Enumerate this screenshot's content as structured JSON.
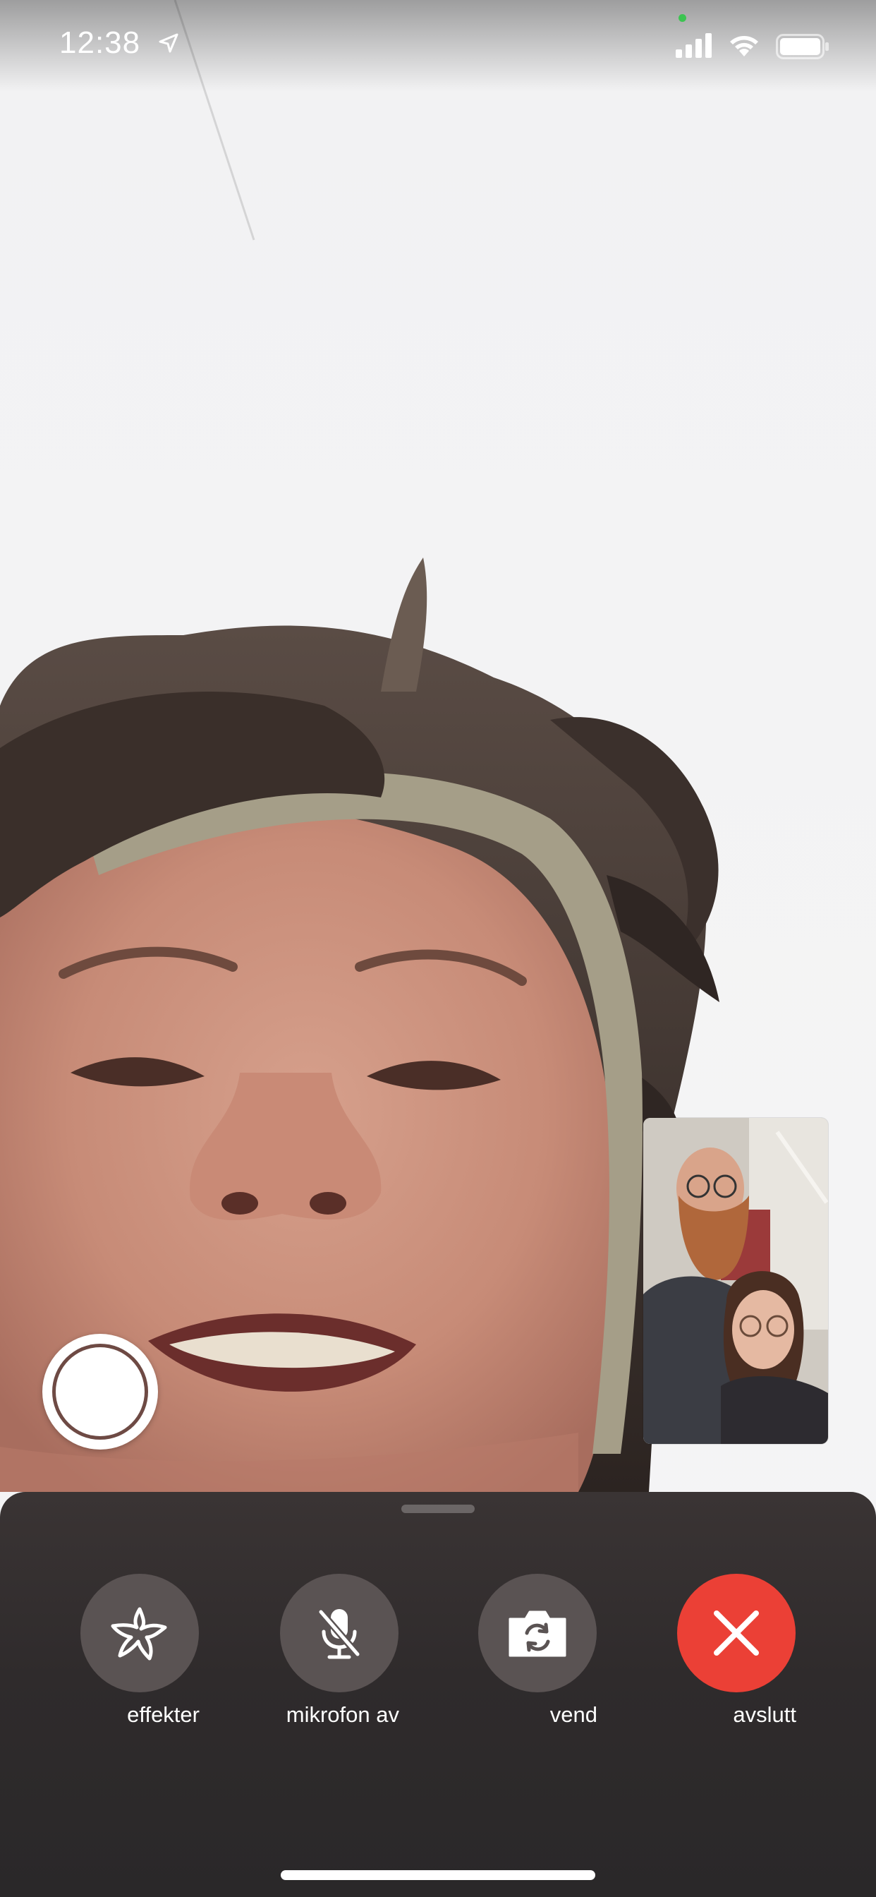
{
  "status_bar": {
    "time": "12:38"
  },
  "controls": [
    {
      "label": "effekter",
      "icon": "effects-star-icon"
    },
    {
      "label": "mikrofon av",
      "icon": "microphone-off-icon"
    },
    {
      "label": "vend",
      "icon": "flip-camera-icon"
    },
    {
      "label": "avslutt",
      "icon": "close-x-icon",
      "color": "#eb4036"
    }
  ]
}
